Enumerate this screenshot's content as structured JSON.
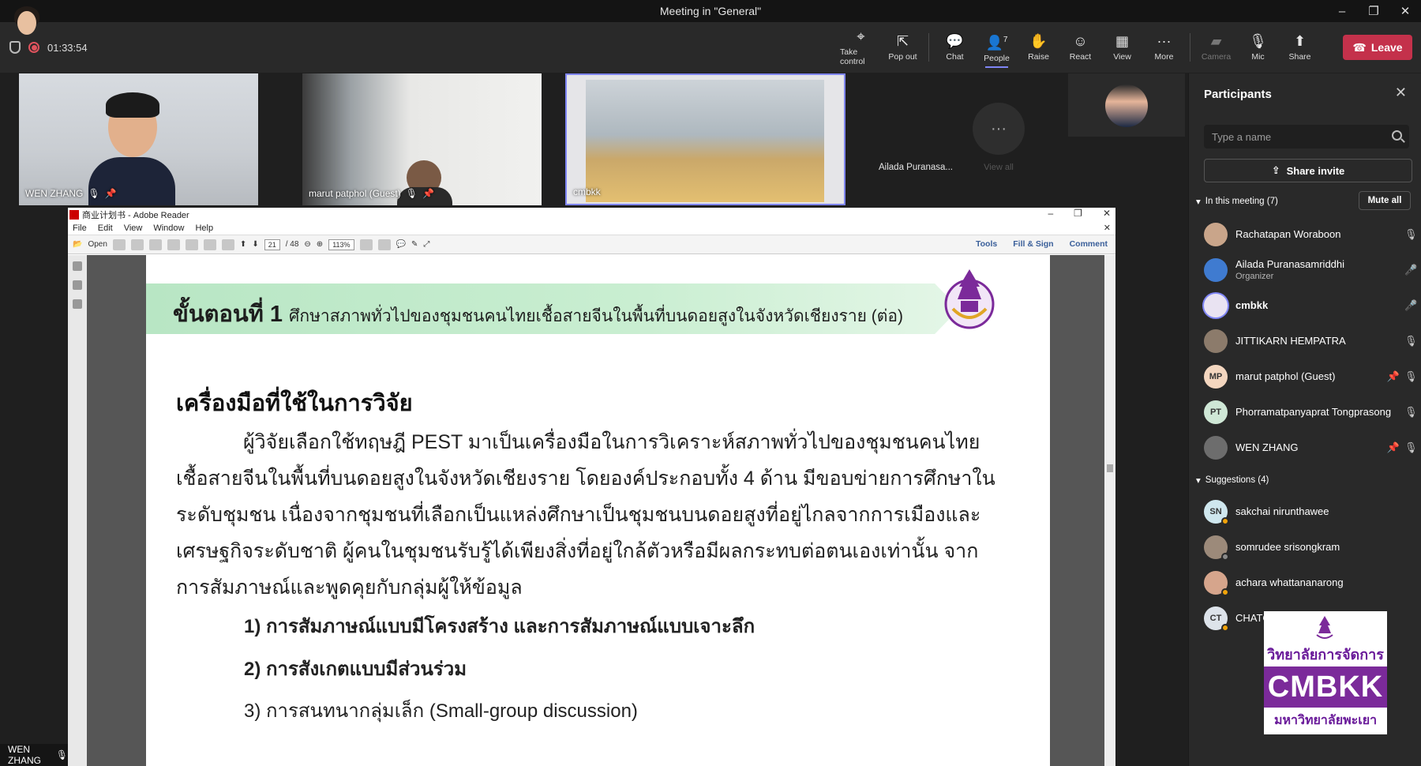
{
  "window": {
    "title": "Meeting in \"General\""
  },
  "toolbar": {
    "timer": "01:33:54",
    "buttons": [
      {
        "label": "Take control",
        "icon": "take-control-icon"
      },
      {
        "label": "Pop out",
        "icon": "pop-out-icon"
      },
      {
        "label": "Chat",
        "icon": "chat-icon"
      },
      {
        "label": "People",
        "icon": "people-icon",
        "badge": "7"
      },
      {
        "label": "Raise",
        "icon": "hand-icon"
      },
      {
        "label": "React",
        "icon": "smile-icon"
      },
      {
        "label": "View",
        "icon": "view-icon"
      },
      {
        "label": "More",
        "icon": "more-icon"
      },
      {
        "label": "Camera",
        "icon": "camera-off-icon"
      },
      {
        "label": "Mic",
        "icon": "mic-off-icon"
      },
      {
        "label": "Share",
        "icon": "share-icon"
      }
    ],
    "leave_label": "Leave"
  },
  "video": {
    "tiles": [
      {
        "name": "WEN ZHANG"
      },
      {
        "name": "marut patphol (Guest)"
      },
      {
        "name": "cmbkk"
      }
    ],
    "avatar_name": "Ailada Puranasa...",
    "view_all_label": "View all"
  },
  "reader": {
    "title": "商业计划书 - Adobe Reader",
    "menu": [
      "File",
      "Edit",
      "View",
      "Window",
      "Help"
    ],
    "open_label": "Open",
    "page_current": "21",
    "page_total": "/ 48",
    "zoom": "113%",
    "right_tools": [
      "Tools",
      "Fill & Sign",
      "Comment"
    ]
  },
  "slide": {
    "step": "ขั้นตอนที่ 1",
    "banner_title": "ศึกษาสภาพทั่วไปของชุมชนคนไทยเชื้อสายจีนในพื้นที่บนดอยสูงในจังหวัดเชียงราย (ต่อ)",
    "heading": "เครื่องมือที่ใช้ในการวิจัย",
    "paragraph": "ผู้วิจัยเลือกใช้ทฤษฎี PEST มาเป็นเครื่องมือในการวิเคราะห์สภาพทั่วไปของชุมชนคนไทยเชื้อสายจีนในพื้นที่บนดอยสูงในจังหวัดเชียงราย โดยองค์ประกอบทั้ง 4 ด้าน มีขอบข่ายการศึกษาในระดับชุมชน เนื่องจากชุมชนที่เลือกเป็นแหล่งศึกษาเป็นชุมชนบนดอยสูงที่อยู่ไกลจากการเมืองและเศรษฐกิจระดับชาติ ผู้คนในชุมชนรับรู้ได้เพียงสิ่งที่อยู่ใกล้ตัวหรือมีผลกระทบต่อตนเองเท่านั้น จากการสัมภาษณ์และพูดคุยกับกลุ่มผู้ให้ข้อมูล",
    "items": [
      "1) การสัมภาษณ์แบบมีโครงสร้าง และการสัมภาษณ์แบบเจาะลึก",
      "2) การสังเกตแบบมีส่วนร่วม",
      "3) การสนทนากลุ่มเล็ก (Small-group discussion)"
    ]
  },
  "panel": {
    "title": "Participants",
    "search_placeholder": "Type a name",
    "share_invite": "Share invite",
    "in_meeting_label": "In this meeting (7)",
    "mute_all": "Mute all",
    "participants": [
      {
        "name": "Rachatapan Woraboon",
        "sub": "",
        "initials": "",
        "color": "#c9a58a"
      },
      {
        "name": "Ailada Puranasamriddhi",
        "sub": "Organizer",
        "initials": "",
        "color": "#3f7bd0"
      },
      {
        "name": "cmbkk",
        "sub": "",
        "initials": "",
        "color": "#e9e3f2"
      },
      {
        "name": "JITTIKARN HEMPATRA",
        "sub": "",
        "initials": "",
        "color": "#8c7b6b"
      },
      {
        "name": "marut patphol (Guest)",
        "sub": "",
        "initials": "MP",
        "color": "#f3d6bf"
      },
      {
        "name": "Phorramatpanyaprat Tongprasong",
        "sub": "",
        "initials": "PT",
        "color": "#cfe7d6"
      },
      {
        "name": "WEN ZHANG",
        "sub": "",
        "initials": "",
        "color": "#6d6d6d"
      }
    ],
    "suggestions_label": "Suggestions (4)",
    "suggestions": [
      {
        "name": "sakchai nirunthawee",
        "initials": "SN",
        "color": "#cfe7ee"
      },
      {
        "name": "somrudee srisongkram",
        "initials": "",
        "color": "#9c8a7a"
      },
      {
        "name": "achara whattananarong",
        "initials": "",
        "color": "#d6a58c"
      },
      {
        "name": "CHATCHAPAPORN SRIPETKUL",
        "initials": "CT",
        "color": "#dde3ea"
      }
    ]
  },
  "self": {
    "name": "WEN ZHANG"
  },
  "overlay_logo": {
    "top_text": "วิทยาลัยการจัดการ",
    "main_text": "CMBKK",
    "bottom_text": "มหาวิทยาลัยพะเยา"
  },
  "colors": {
    "accent": "#7f85f5",
    "leave": "#c4314b",
    "banner": "#c9eed1",
    "brand_purple": "#7b2a9a"
  }
}
